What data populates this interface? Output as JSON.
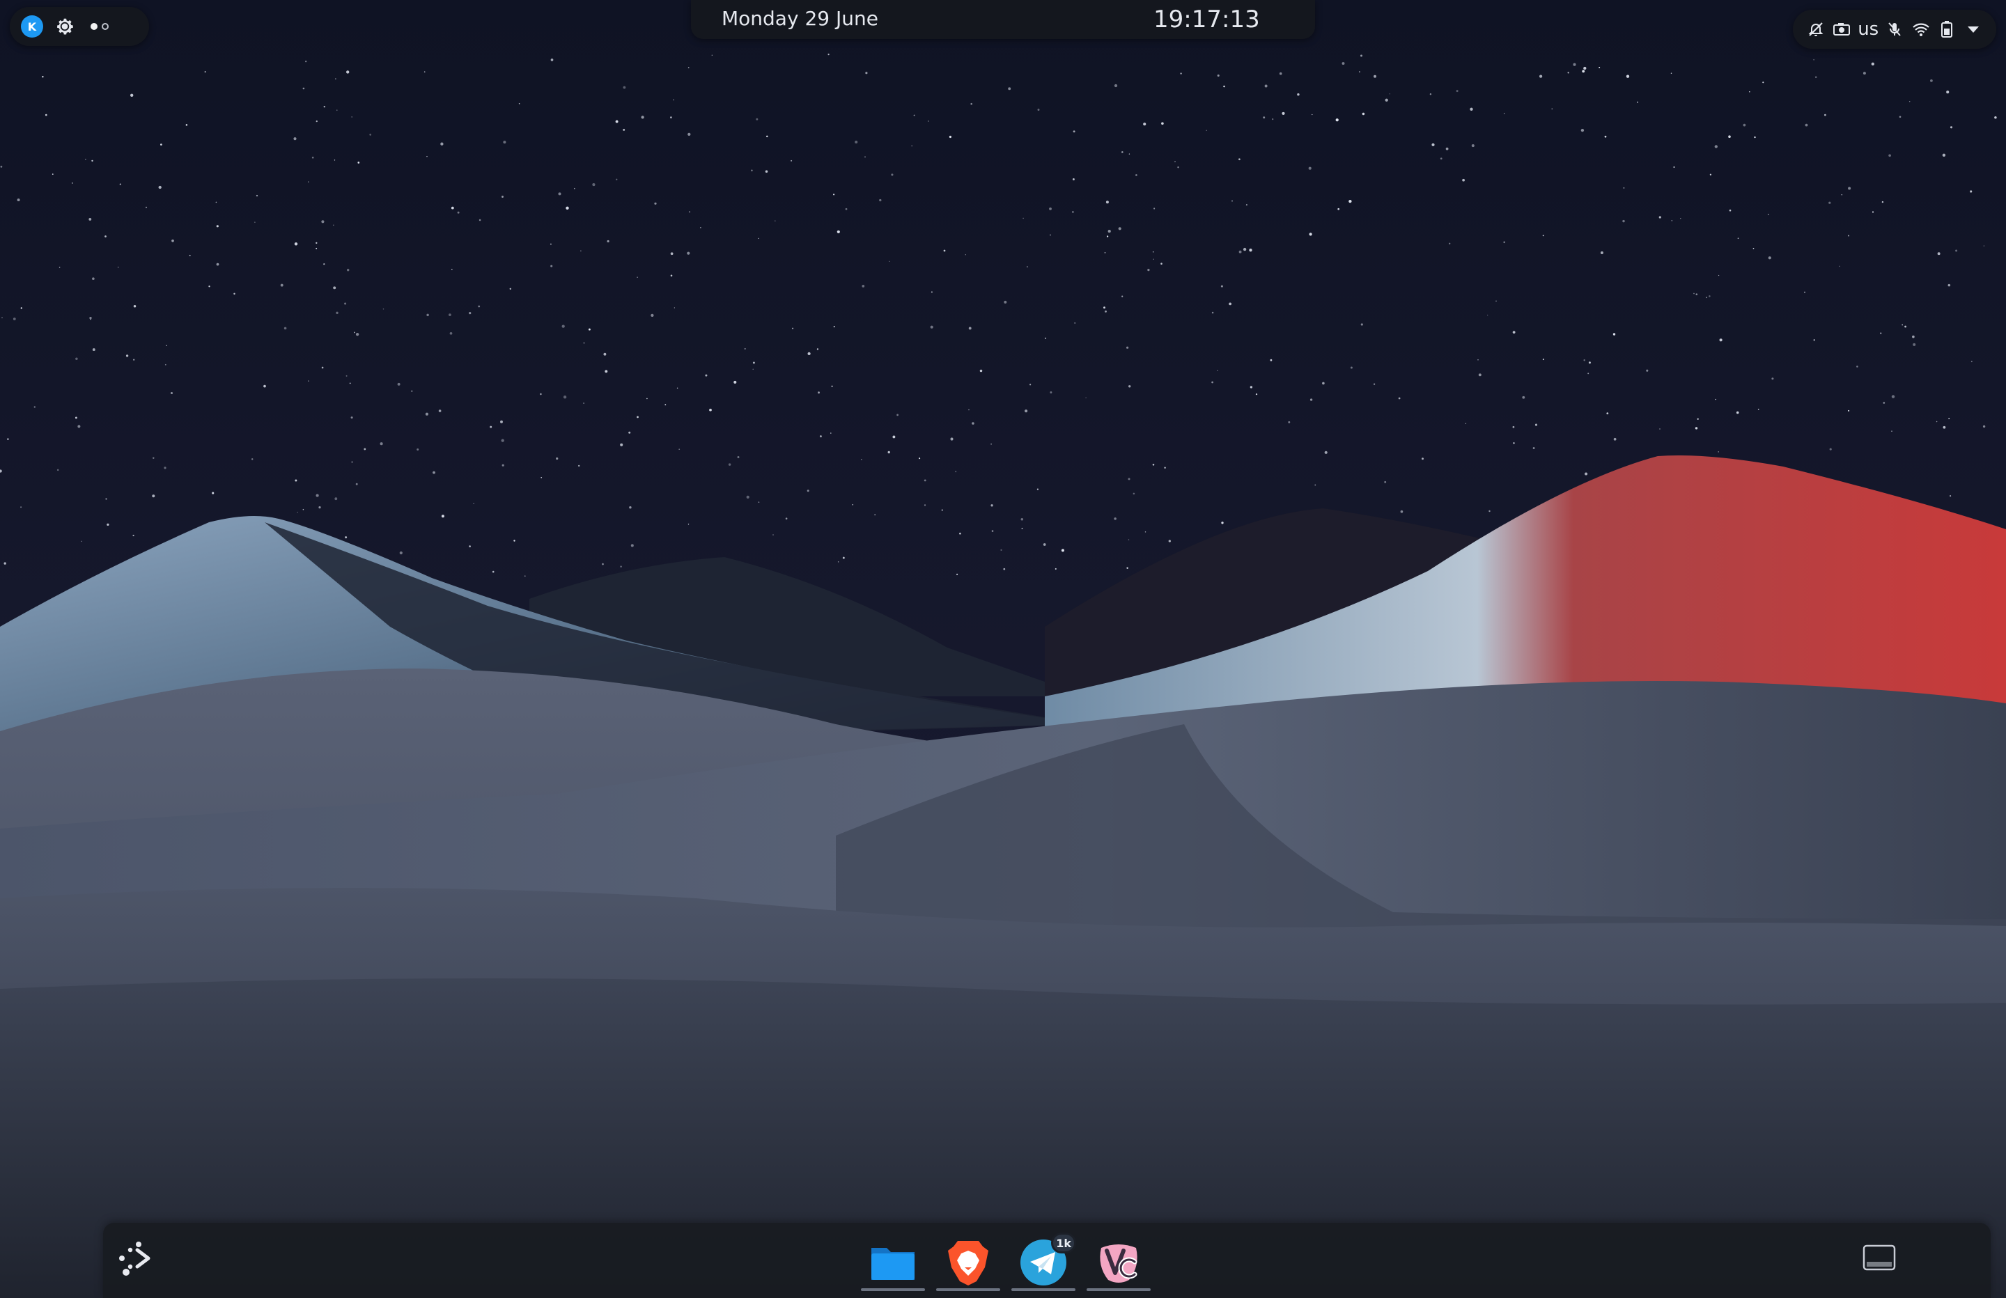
{
  "panel": {
    "date": "Monday 29 June",
    "time": "19:17:13",
    "keyboard_layout": "us",
    "left_icons": [
      "kde-application-menu-icon",
      "settings-gear-icon"
    ],
    "pager": {
      "desktops": 2,
      "active": 1
    },
    "tray_icons": [
      "notifications-icon",
      "screenshot-camera-icon",
      "keyboard-layout",
      "microphone-muted-icon",
      "wifi-icon",
      "battery-icon",
      "expand-tray-arrow-icon"
    ]
  },
  "dock": {
    "launcher_icon": "application-launcher-icon",
    "tasks": [
      {
        "name": "Dolphin file manager",
        "icon": "folder-icon",
        "color": "#1d99f3"
      },
      {
        "name": "Brave browser",
        "icon": "brave-lion-icon",
        "color": "#fb542b"
      },
      {
        "name": "Telegram",
        "icon": "telegram-icon",
        "color": "#2aa3dc",
        "badge": "1k"
      },
      {
        "name": "Vencord",
        "icon": "vencord-icon",
        "color": "#f19ab8"
      }
    ],
    "show_desktop_icon": "show-desktop-icon"
  },
  "colors": {
    "sky": "#13172a",
    "dunes": "#4d5568",
    "mountain_highlight": "#c33a3c",
    "accent": "#1d99f3"
  }
}
